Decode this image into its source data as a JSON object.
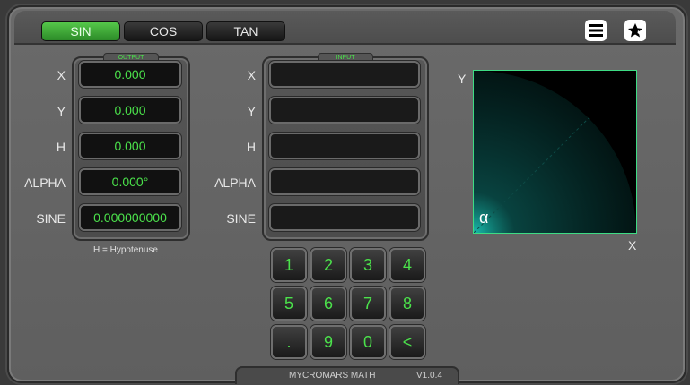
{
  "tabs": [
    {
      "label": "SIN",
      "active": true
    },
    {
      "label": "COS",
      "active": false
    },
    {
      "label": "TAN",
      "active": false
    }
  ],
  "icons": {
    "menu": "hamburger-menu-icon",
    "favorite": "star-icon"
  },
  "output_panel": {
    "title": "OUTPUT",
    "rows": [
      {
        "label": "X",
        "value": "0.000"
      },
      {
        "label": "Y",
        "value": "0.000"
      },
      {
        "label": "H",
        "value": "0.000"
      },
      {
        "label": "ALPHA",
        "value": "0.000°"
      },
      {
        "label": "SINE",
        "value": "0.000000000"
      }
    ],
    "note": "H = Hypotenuse"
  },
  "input_panel": {
    "title": "INPUT",
    "rows": [
      {
        "label": "X",
        "value": ""
      },
      {
        "label": "Y",
        "value": ""
      },
      {
        "label": "H",
        "value": ""
      },
      {
        "label": "ALPHA",
        "value": ""
      },
      {
        "label": "SINE",
        "value": ""
      }
    ]
  },
  "keypad": [
    [
      "1",
      "2",
      "3",
      "4"
    ],
    [
      "5",
      "6",
      "7",
      "8"
    ],
    [
      ".",
      "9",
      "0",
      "<"
    ]
  ],
  "plot": {
    "y_label": "Y",
    "x_label": "X",
    "angle_symbol": "α"
  },
  "footer": {
    "app_name": "MYCROMARS MATH",
    "version": "V1.0.4"
  },
  "colors": {
    "accent_green": "#4be24b",
    "tab_active": "#3aa83a",
    "plot_line": "#3ddc84"
  }
}
